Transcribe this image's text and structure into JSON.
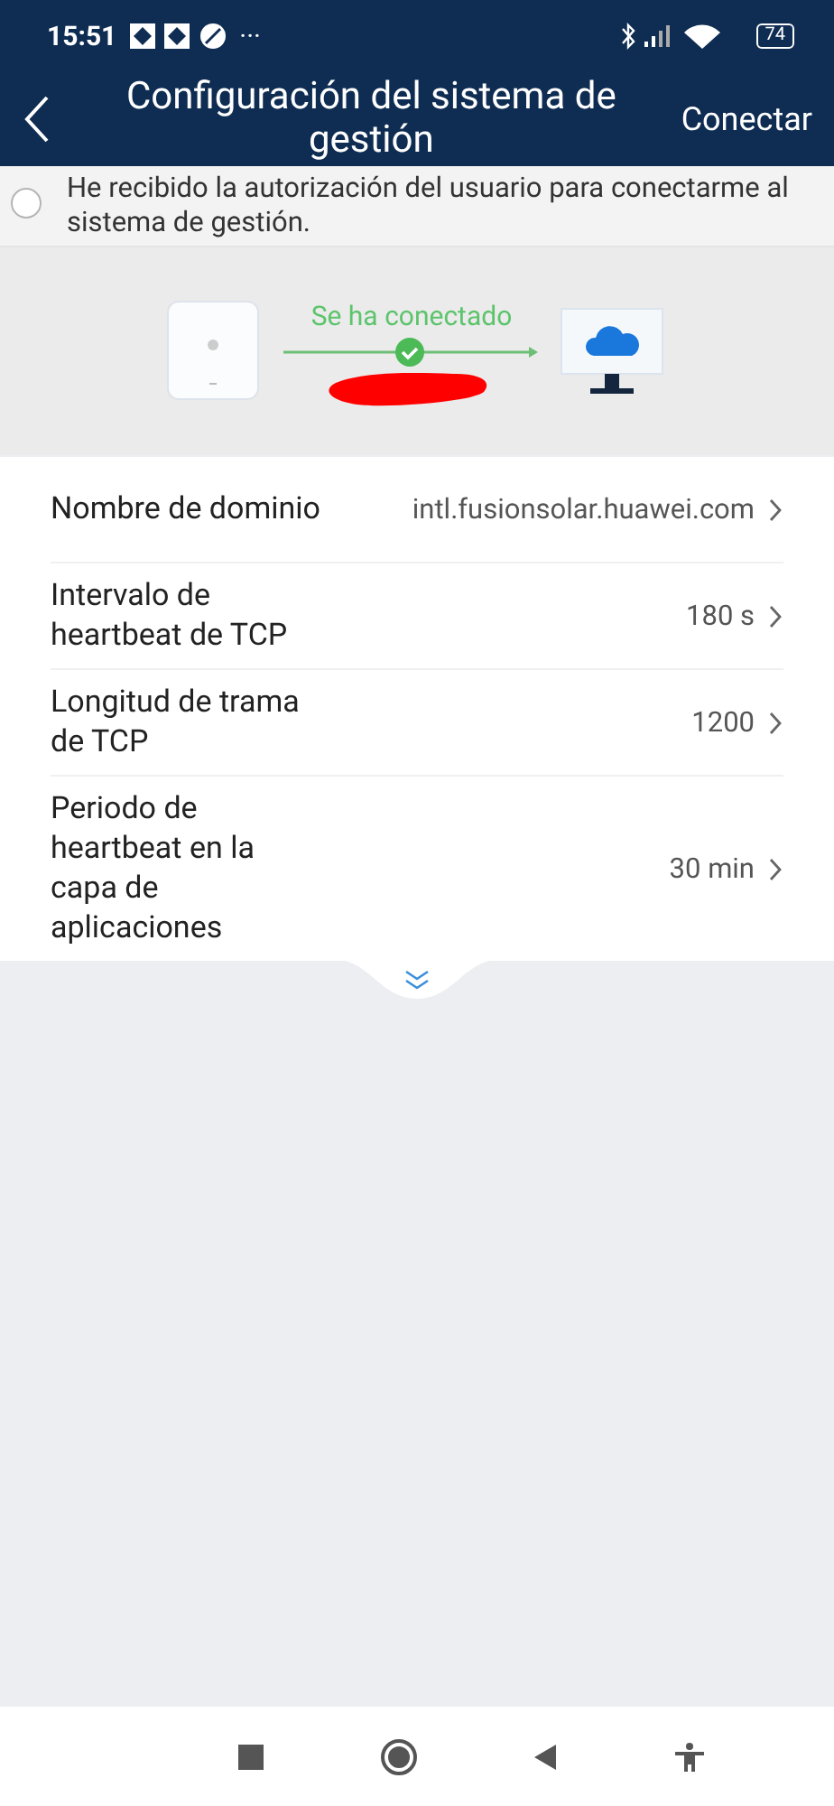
{
  "status_bar": {
    "time": "15:51",
    "more": "···",
    "battery": "74"
  },
  "header": {
    "title": "Configuración del sistema de gestión",
    "action": "Conectar"
  },
  "authorization": {
    "text": "He recibido la autorización del usuario para conectarme al sistema de gestión.",
    "checked": false
  },
  "connection": {
    "status": "Se ha conectado",
    "connected": true
  },
  "settings": [
    {
      "label": "Nombre de dominio",
      "value": "intl.fusionsolar.huawei.com"
    },
    {
      "label": "Intervalo de heartbeat de TCP",
      "value": "180 s"
    },
    {
      "label": "Longitud de trama de TCP",
      "value": "1200"
    },
    {
      "label": "Periodo de heartbeat en la capa de aplicaciones",
      "value": "30 min"
    }
  ]
}
